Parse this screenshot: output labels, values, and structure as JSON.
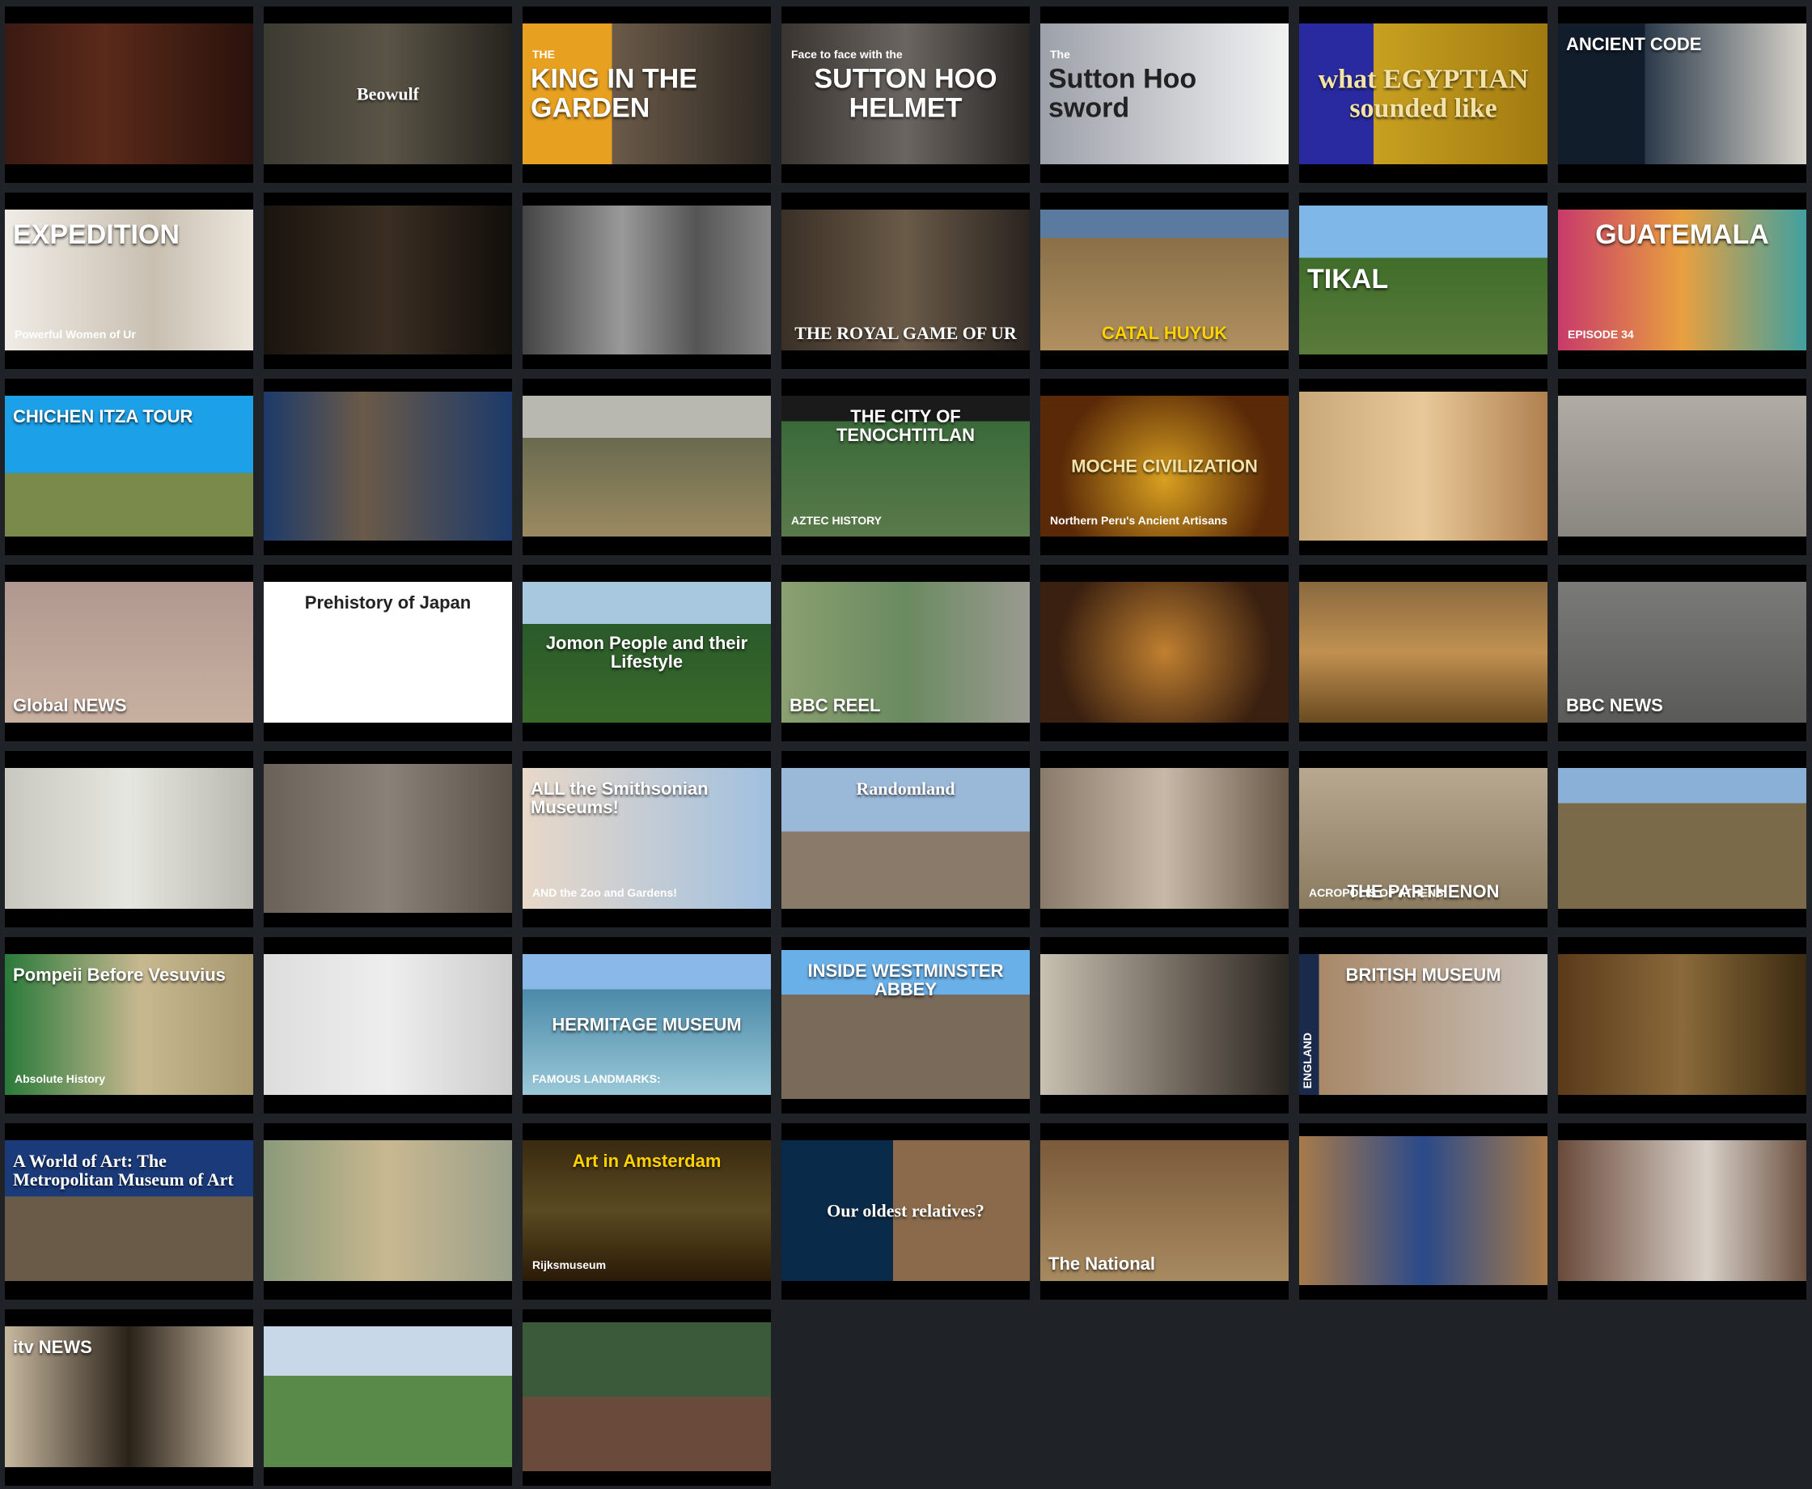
{
  "tiles": [
    {
      "id": "reading",
      "caption": "",
      "thumb": "linear-gradient(90deg,#3a1a12,#5a2a1a 40%,#2a120c)"
    },
    {
      "id": "beowulf",
      "caption": "Beowulf",
      "thumb": "linear-gradient(90deg,#3d3a32,#5a5446 50%,#26231e)"
    },
    {
      "id": "king-garden",
      "caption": "KING IN THE GARDEN",
      "prefix": "THE",
      "thumb": "linear-gradient(90deg,#e8a020 0 36%,#6b5a48 36%,#2c2822)"
    },
    {
      "id": "sutton-helmet",
      "caption": "SUTTON HOO HELMET",
      "prefix": "Face to face with the",
      "thumb": "linear-gradient(90deg,#3a3430,#6a6560 50%,#2a2624)"
    },
    {
      "id": "sutton-sword",
      "caption": "Sutton Hoo sword",
      "prefix": "The",
      "thumb": "linear-gradient(90deg,#9ca0a8,#d0d2d6 60%,#f2f2f2)"
    },
    {
      "id": "egyptian",
      "caption": "what EGYPTIAN sounded like",
      "thumb": "linear-gradient(90deg,#2a2aa0 0 30%,#c8a020 30%,#a07a10)"
    },
    {
      "id": "ancient-code",
      "caption": "ANCIENT CODE",
      "thumb": "linear-gradient(90deg,#121d2b 0 35%,#2b3a4a 35%,#d9d5cc)"
    },
    {
      "id": "expedition",
      "caption": "EXPEDITION",
      "sub": "Powerful Women of Ur",
      "thumb": "linear-gradient(90deg,#f0ece6,#c8bfb0 60%,#ece6dc)"
    },
    {
      "id": "cave",
      "caption": "",
      "thumb": "linear-gradient(90deg,#1a140e,#3a2e22 50%,#120e0a)"
    },
    {
      "id": "archive",
      "caption": "",
      "thumb": "linear-gradient(90deg,#444,#999 40%,#555 70%,#888)"
    },
    {
      "id": "royal-game-ur",
      "caption": "THE ROYAL GAME OF UR",
      "thumb": "linear-gradient(90deg,#3a3026,#6a5a48 50%,#2a2420)"
    },
    {
      "id": "catal-huyuk",
      "caption": "CATAL HUYUK",
      "thumb": "linear-gradient(180deg,#5a7aa0 0 20%,#8a7048 20%,#b09060)"
    },
    {
      "id": "tikal",
      "caption": "TIKAL",
      "thumb": "linear-gradient(180deg,#7fb8e8 0 35%,#3f6d2a 35%,#5a7a3a)"
    },
    {
      "id": "guatemala",
      "caption": "GUATEMALA",
      "sub": "EPISODE 34",
      "thumb": "linear-gradient(90deg,#c83a6a,#e8a040 50%,#40a0a0)"
    },
    {
      "id": "chichen",
      "caption": "CHICHEN ITZA TOUR",
      "thumb": "linear-gradient(180deg,#1ca0e8 0 55%,#7a8a4a 55%)"
    },
    {
      "id": "aztec-stone",
      "caption": "",
      "thumb": "linear-gradient(90deg,#1c3a6a,#6a5a48 40%,#1c3a6a)"
    },
    {
      "id": "teotihuacan",
      "caption": "",
      "thumb": "linear-gradient(180deg,#b8b8b0 0 30%,#6a6a50 30%,#9a8a60)"
    },
    {
      "id": "tenochtitlan",
      "caption": "THE CITY OF TENOCHTITLAN",
      "sub": "AZTEC HISTORY",
      "thumb": "linear-gradient(180deg,#1a1a1a 0 18%,#3a6a3a 18%,#5a7a4a)"
    },
    {
      "id": "moche",
      "caption": "MOCHE CIVILIZATION",
      "sub": "Northern Peru's Ancient Artisans",
      "thumb": "radial-gradient(circle at 50% 60%,#d8a020,#5a2a08 70%)"
    },
    {
      "id": "peru-faces",
      "caption": "",
      "thumb": "linear-gradient(90deg,#c8a878,#e8c898 50%,#b08050)"
    },
    {
      "id": "nazca-lines",
      "caption": "",
      "thumb": "linear-gradient(180deg,#b0aca4,#8a8680)"
    },
    {
      "id": "nazca-cat",
      "caption": "Global NEWS",
      "thumb": "linear-gradient(180deg,#b09890,#c8b0a0)"
    },
    {
      "id": "japan",
      "caption": "Prehistory of Japan",
      "thumb": "linear-gradient(180deg,#fff 0 40%,#fff 40%)"
    },
    {
      "id": "jomon",
      "caption": "Jomon People and their Lifestyle",
      "thumb": "linear-gradient(180deg,#a8c8e0 0 30%,#2a5a2a 30%,#3a6a2a)"
    },
    {
      "id": "bbc-reel",
      "caption": "BBC REEL",
      "thumb": "linear-gradient(90deg,#8aa070,#6a8a60 50%,#9a9a90)"
    },
    {
      "id": "terracotta-lit",
      "caption": "",
      "thumb": "radial-gradient(circle at 50% 50%,#c08030,#3a2010 75%)"
    },
    {
      "id": "terracotta-rows",
      "caption": "",
      "thumb": "linear-gradient(180deg,#8a6a40,#c09050 50%,#6a4a20)"
    },
    {
      "id": "bbc-news",
      "caption": "BBC NEWS",
      "thumb": "linear-gradient(180deg,#7a7a78,#5a5a58)"
    },
    {
      "id": "portrait",
      "caption": "",
      "thumb": "linear-gradient(90deg,#c8c8c0,#e6e6e0 50%,#b8b8b0)"
    },
    {
      "id": "arch",
      "caption": "",
      "thumb": "linear-gradient(90deg,#6a6258,#8a8278 50%,#5a5248)"
    },
    {
      "id": "smithsonian",
      "caption": "ALL the Smithsonian Museums!",
      "sub": "AND the Zoo and Gardens!",
      "thumb": "linear-gradient(90deg,#e8d8c8,#a0c0e0)"
    },
    {
      "id": "randomland",
      "caption": "Randomland",
      "thumb": "linear-gradient(180deg,#9ab8d8 0 45%,#8a7a6a 45%)"
    },
    {
      "id": "restoration",
      "caption": "",
      "thumb": "linear-gradient(90deg,#8a7a6a,#c8b8a8 50%,#6a5a4a)"
    },
    {
      "id": "parthenon",
      "caption": "THE PARTHENON",
      "sub": "ACROPOLIS OF ATHENS",
      "thumb": "linear-gradient(180deg,#b8a890,#8a7a60)"
    },
    {
      "id": "acropolis",
      "caption": "",
      "thumb": "linear-gradient(180deg,#8ab0d8 0 25%,#7a6a4a 25%)"
    },
    {
      "id": "pompeii",
      "caption": "Pompeii Before Vesuvius",
      "sub": "Absolute History",
      "thumb": "linear-gradient(90deg,#2a7a3a,#c8b890 55%,#a89870)"
    },
    {
      "id": "conversation",
      "caption": "",
      "thumb": "linear-gradient(90deg,#ddd,#eee 50%,#ccc)"
    },
    {
      "id": "hermitage",
      "caption": "HERMITAGE MUSEUM",
      "sub": "FAMOUS LANDMARKS:",
      "thumb": "linear-gradient(180deg,#8ab8e8 0 25%,#4a8aa8 25%,#9ac8d8)"
    },
    {
      "id": "westminster",
      "caption": "INSIDE WESTMINSTER ABBEY",
      "thumb": "linear-gradient(180deg,#6ab0e8 0 30%,#7a6a5a 30%)"
    },
    {
      "id": "westminster-statue",
      "caption": "",
      "thumb": "linear-gradient(90deg,#c8c0b0,#6a6258 60%,#2a2620)"
    },
    {
      "id": "british-museum",
      "caption": "BRITISH MUSEUM",
      "side": "ENGLAND",
      "thumb": "linear-gradient(90deg,#1a2a4a 0 8%,#a88868 8%,#c8c0b8)"
    },
    {
      "id": "bosch",
      "caption": "",
      "thumb": "linear-gradient(90deg,#5a3a1a,#8a6a3a 50%,#3a2a10)"
    },
    {
      "id": "met",
      "caption": "A World of Art: The Metropolitan Museum of Art",
      "thumb": "linear-gradient(180deg,#1a3a7a 0 40%,#6a5a48 40%)"
    },
    {
      "id": "botticelli",
      "caption": "",
      "thumb": "linear-gradient(90deg,#8a9a7a,#c8b890 50%,#9aa08a)"
    },
    {
      "id": "amsterdam",
      "caption": "Art in Amsterdam",
      "sub": "Rijksmuseum",
      "thumb": "linear-gradient(180deg,#3a2a10,#5a4a20 50%,#2a1a08)"
    },
    {
      "id": "dw",
      "caption": "Our oldest relatives?",
      "thumb": "linear-gradient(90deg,#0a2a4a 0 45%,#8a6a4a 45%)"
    },
    {
      "id": "the-national",
      "caption": "The National",
      "thumb": "linear-gradient(180deg,#7a5a3a,#a88a60)"
    },
    {
      "id": "printer",
      "caption": "",
      "thumb": "linear-gradient(90deg,#a87a4a,#2a4a8a 50%,#a87a4a)"
    },
    {
      "id": "nasa",
      "caption": "",
      "thumb": "linear-gradient(90deg,#6a4a3a,#d8d0c8 60%,#6a5040)"
    },
    {
      "id": "itv-news",
      "caption": "itv NEWS",
      "thumb": "linear-gradient(90deg,#c8b8a0,#2a2218 50%,#d8c8b0)"
    },
    {
      "id": "kids",
      "caption": "",
      "thumb": "linear-gradient(180deg,#c8d8e8 0 35%,#5a8a4a 35%)"
    },
    {
      "id": "train",
      "caption": "",
      "thumb": "linear-gradient(180deg,#3a5a3a 0 50%,#6a4a3a 50%)"
    }
  ]
}
